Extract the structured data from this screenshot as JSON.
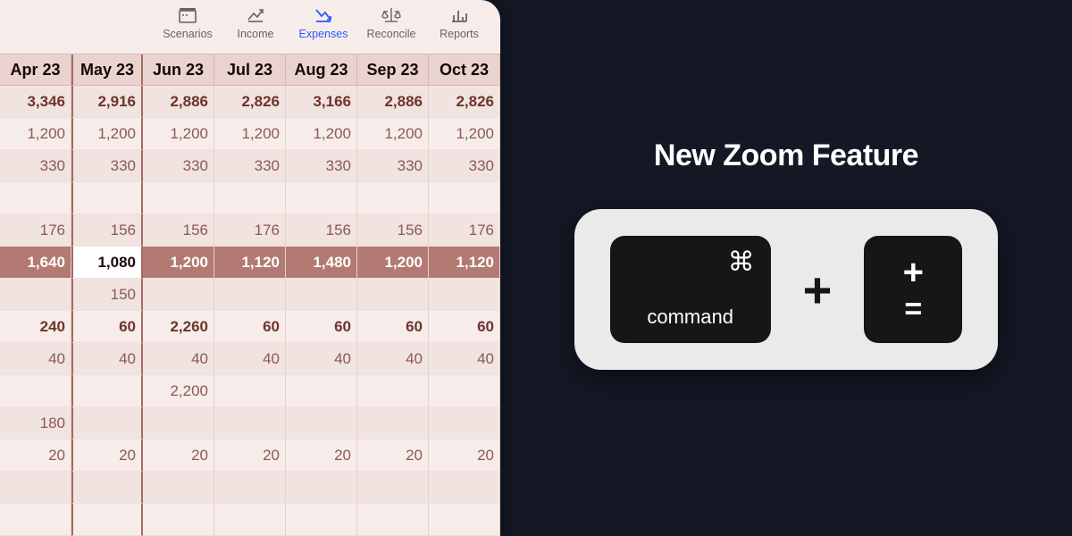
{
  "toolbar": {
    "items": [
      {
        "id": "scenarios",
        "label": "Scenarios",
        "active": false
      },
      {
        "id": "income",
        "label": "Income",
        "active": false
      },
      {
        "id": "expenses",
        "label": "Expenses",
        "active": true
      },
      {
        "id": "reconcile",
        "label": "Reconcile",
        "active": false
      },
      {
        "id": "reports",
        "label": "Reports",
        "active": false
      }
    ]
  },
  "grid": {
    "months": [
      "Apr 23",
      "May 23",
      "Jun 23",
      "Jul 23",
      "Aug 23",
      "Sep 23",
      "Oct 23"
    ],
    "current_month_index": 1,
    "rows": [
      {
        "style": "total",
        "values": [
          "3,346",
          "2,916",
          "2,886",
          "2,826",
          "3,166",
          "2,886",
          "2,826"
        ]
      },
      {
        "style": "",
        "values": [
          "1,200",
          "1,200",
          "1,200",
          "1,200",
          "1,200",
          "1,200",
          "1,200"
        ]
      },
      {
        "style": "",
        "values": [
          "330",
          "330",
          "330",
          "330",
          "330",
          "330",
          "330"
        ]
      },
      {
        "style": "",
        "values": [
          "",
          "",
          "",
          "",
          "",
          "",
          ""
        ]
      },
      {
        "style": "",
        "values": [
          "176",
          "156",
          "156",
          "176",
          "156",
          "156",
          "176"
        ]
      },
      {
        "style": "band",
        "values": [
          "1,640",
          "1,080",
          "1,200",
          "1,120",
          "1,480",
          "1,200",
          "1,120"
        ],
        "lit_index": 1
      },
      {
        "style": "",
        "values": [
          "",
          "150",
          "",
          "",
          "",
          "",
          ""
        ]
      },
      {
        "style": "bold",
        "values": [
          "240",
          "60",
          "2,260",
          "60",
          "60",
          "60",
          "60"
        ]
      },
      {
        "style": "",
        "values": [
          "40",
          "40",
          "40",
          "40",
          "40",
          "40",
          "40"
        ]
      },
      {
        "style": "",
        "values": [
          "",
          "",
          "2,200",
          "",
          "",
          "",
          ""
        ]
      },
      {
        "style": "",
        "values": [
          "180",
          "",
          "",
          "",
          "",
          "",
          ""
        ]
      },
      {
        "style": "",
        "values": [
          "20",
          "20",
          "20",
          "20",
          "20",
          "20",
          "20"
        ]
      },
      {
        "style": "",
        "values": [
          "",
          "",
          "",
          "",
          "",
          "",
          ""
        ]
      },
      {
        "style": "",
        "values": [
          "",
          "",
          "",
          "",
          "",
          "",
          ""
        ]
      }
    ]
  },
  "callout": {
    "title": "New Zoom Feature",
    "key1_glyph": "⌘",
    "key1_label": "command",
    "separator": "+",
    "key2_top": "+",
    "key2_bottom": "="
  }
}
